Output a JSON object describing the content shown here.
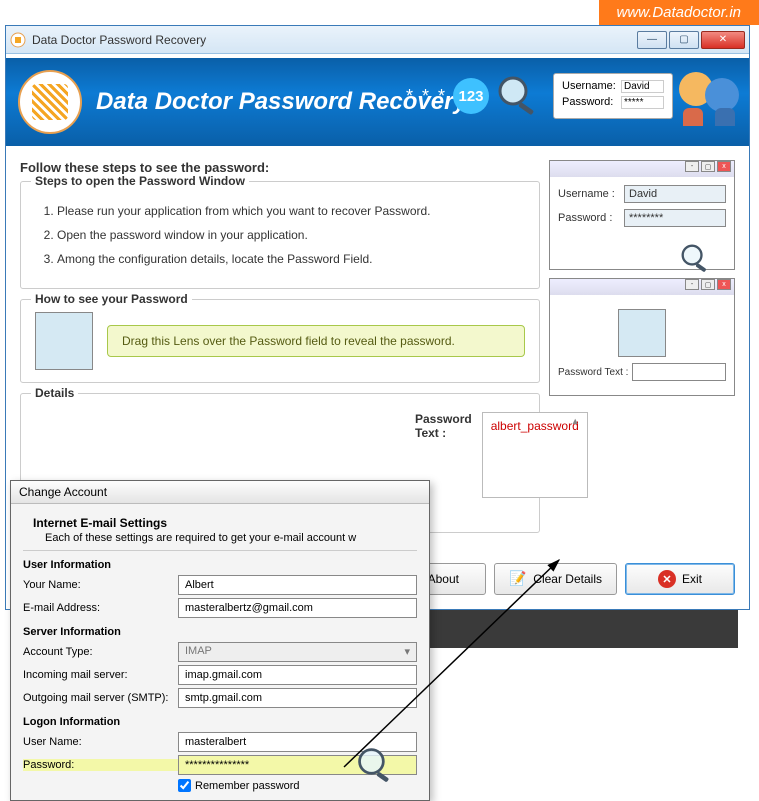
{
  "url_banner": "www.Datadoctor.in",
  "window": {
    "title": "Data Doctor Password Recovery",
    "header_title": "Data Doctor Password Recovery",
    "num_badge": "123",
    "cred_preview": {
      "username_lbl": "Username:",
      "username": "David",
      "password_lbl": "Password:",
      "password": "*****"
    }
  },
  "content": {
    "follow_heading": "Follow these steps to see the password:",
    "steps_legend": "Steps to open the Password Window",
    "steps": [
      "Please run your application from which you want to recover Password.",
      "Open the password window in your application.",
      "Among the configuration details, locate the Password Field."
    ],
    "howto_legend": "How to see your Password",
    "howto_hint": "Drag this Lens over the Password field to reveal the password.",
    "details_legend": "Details"
  },
  "side": {
    "username_lbl": "Username  :",
    "username": "David",
    "password_lbl": "Password   :",
    "password": "********",
    "pwdtext_lbl": "Password Text :"
  },
  "result": {
    "label": "Password Text  :",
    "value": "albert_password"
  },
  "buttons": {
    "about": "About",
    "clear": "Clear Details",
    "exit": "Exit"
  },
  "dialog": {
    "title": "Change Account",
    "heading": "Internet E-mail Settings",
    "sub": "Each of these settings are required to get your e-mail account w",
    "sec_user": "User Information",
    "your_name_lbl": "Your Name:",
    "your_name": "Albert",
    "email_lbl": "E-mail Address:",
    "email": "masteralbertz@gmail.com",
    "sec_server": "Server Information",
    "acct_type_lbl": "Account Type:",
    "acct_type": "IMAP",
    "incoming_lbl": "Incoming mail server:",
    "incoming": "imap.gmail.com",
    "outgoing_lbl": "Outgoing mail server (SMTP):",
    "outgoing": "smtp.gmail.com",
    "sec_logon": "Logon Information",
    "user_name_lbl": "User Name:",
    "user_name": "masteralbert",
    "password_lbl": "Password:",
    "password": "***************",
    "remember_lbl": "Remember password"
  }
}
